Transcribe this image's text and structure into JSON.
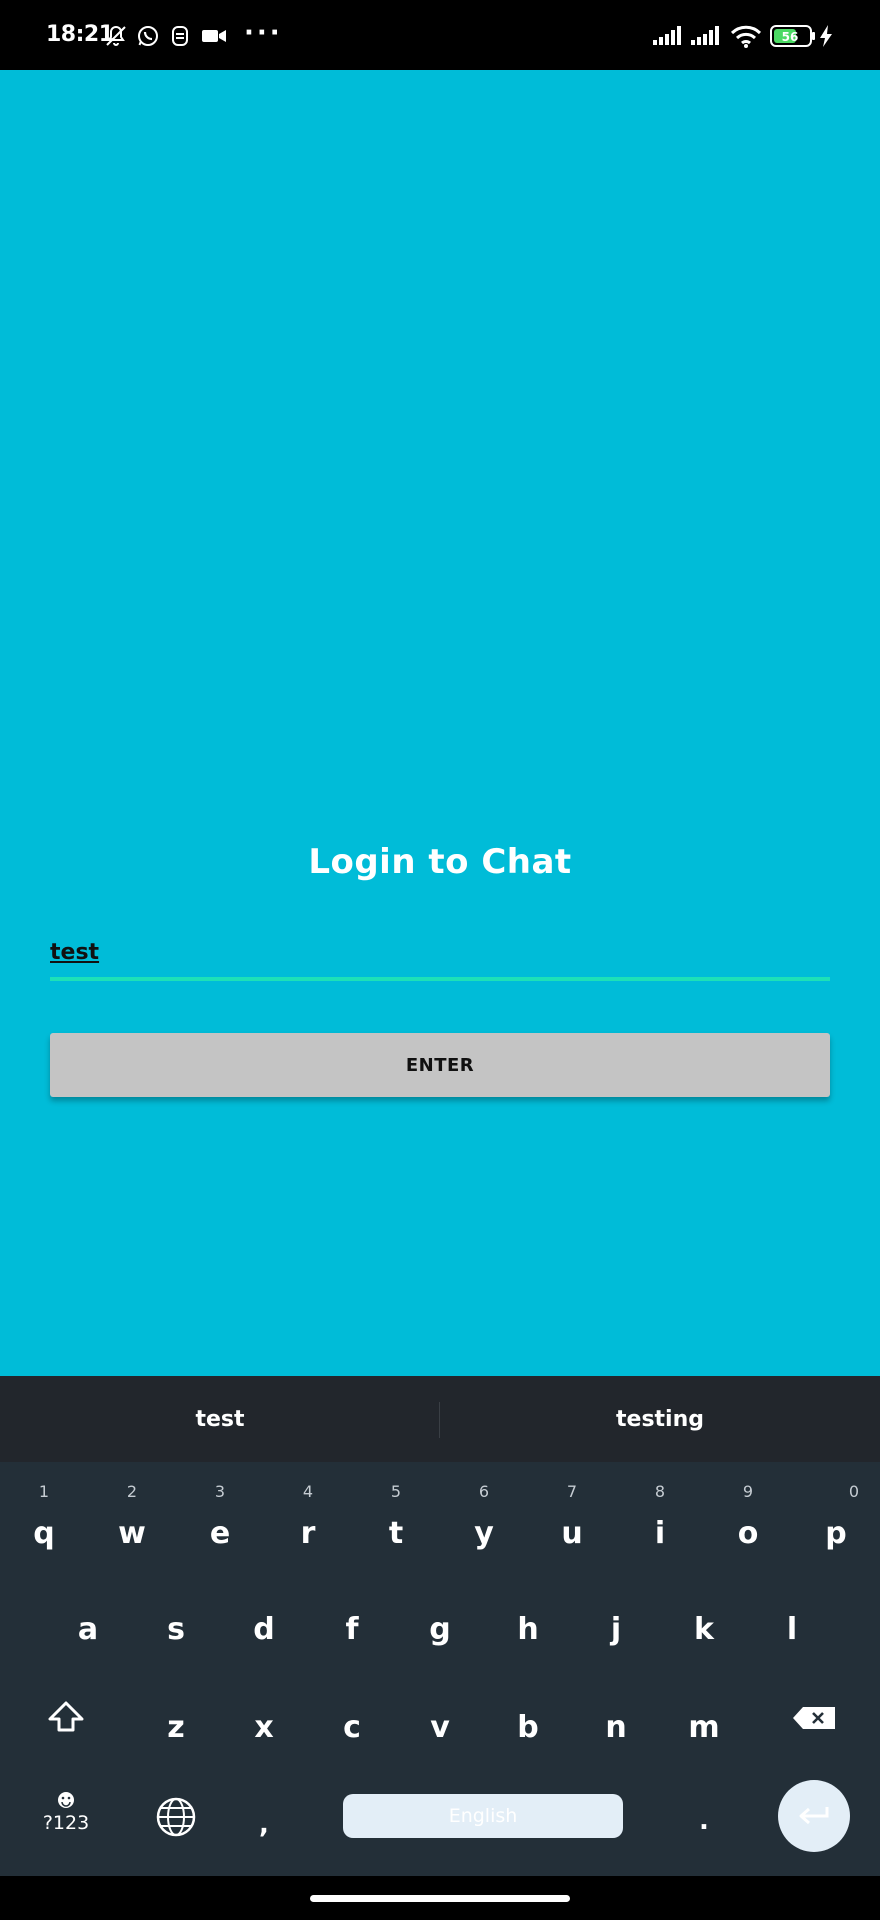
{
  "status_bar": {
    "time": "18:21",
    "battery": "56",
    "more_indicator": "···",
    "icons": [
      "bell-off-icon",
      "whatsapp-icon",
      "app-notification-icon",
      "video-camera-icon",
      "signal-icon",
      "signal-icon",
      "wifi-icon",
      "battery-icon",
      "charging-icon"
    ]
  },
  "login": {
    "title": "Login to Chat",
    "username_value": "test",
    "enter_label": "ENTER"
  },
  "colors": {
    "background": "#00BCD8",
    "field_underline": "#1DE1B7",
    "button": "#C4C4C4",
    "keyboard": "#232F38"
  },
  "keyboard": {
    "suggestions": [
      "test",
      "testing"
    ],
    "row1": [
      "q",
      "w",
      "e",
      "r",
      "t",
      "y",
      "u",
      "i",
      "o",
      "p"
    ],
    "row1_hints": [
      "1",
      "2",
      "3",
      "4",
      "5",
      "6",
      "7",
      "8",
      "9",
      "0"
    ],
    "row2": [
      "a",
      "s",
      "d",
      "f",
      "g",
      "h",
      "j",
      "k",
      "l"
    ],
    "row3": [
      "z",
      "x",
      "c",
      "v",
      "b",
      "n",
      "m"
    ],
    "symbols_label": "?123",
    "comma_label": ",",
    "space_label": "English",
    "period_label": "."
  }
}
